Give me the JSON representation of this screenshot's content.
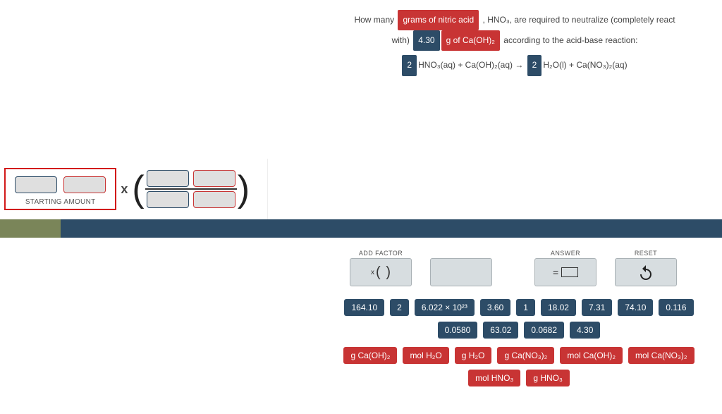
{
  "question": {
    "part1_a": "How many ",
    "pill1": "grams of nitric acid",
    "part1_b": " , HNO₃, are required to neutralize (completely react",
    "part2_a": "with) ",
    "pill2": "4.30",
    "pill3": "g of Ca(OH)₂",
    "part2_b": " according to the acid-base reaction:",
    "eq_coef1": "2",
    "eq_mid": "HNO₃(aq) + Ca(OH)₂(aq) → ",
    "eq_coef2": "2",
    "eq_tail": "H₂O(l) + Ca(NO₃)₂(aq)"
  },
  "starting_label": "STARTING AMOUNT",
  "tools": {
    "add_factor": "ADD FACTOR",
    "answer": "ANSWER",
    "reset": "RESET"
  },
  "number_chips": [
    "164.10",
    "2",
    "6.022 × 10²³",
    "3.60",
    "1",
    "18.02",
    "7.31",
    "74.10",
    "0.116",
    "0.0580",
    "63.02",
    "0.0682",
    "4.30"
  ],
  "unit_chips": [
    "g Ca(OH)₂",
    "mol H₂O",
    "g H₂O",
    "g Ca(NO₃)₂",
    "mol Ca(OH)₂",
    "mol Ca(NO₃)₂",
    "mol HNO₃",
    "g HNO₃"
  ]
}
